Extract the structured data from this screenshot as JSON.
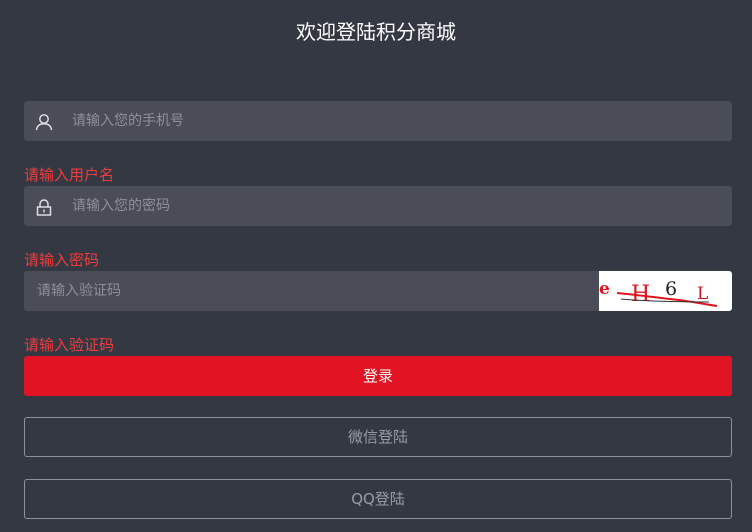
{
  "header": {
    "title": "欢迎登陆积分商城"
  },
  "phone_field": {
    "placeholder": "请输入您的手机号",
    "icon": "user-icon"
  },
  "phone_error": "请输入用户名",
  "password_field": {
    "placeholder": "请输入您的密码",
    "icon": "lock-icon"
  },
  "password_error": "请输入密码",
  "captcha_field": {
    "placeholder": "请输入验证码"
  },
  "captcha_image": {
    "text": "eH6L"
  },
  "captcha_error": "请输入验证码",
  "buttons": {
    "login": "登录",
    "wechat_login": "微信登陆",
    "qq_login": "QQ登陆"
  },
  "colors": {
    "background": "#343843",
    "field": "#4a4d58",
    "primary": "#e21322",
    "error": "#f03c3c"
  }
}
